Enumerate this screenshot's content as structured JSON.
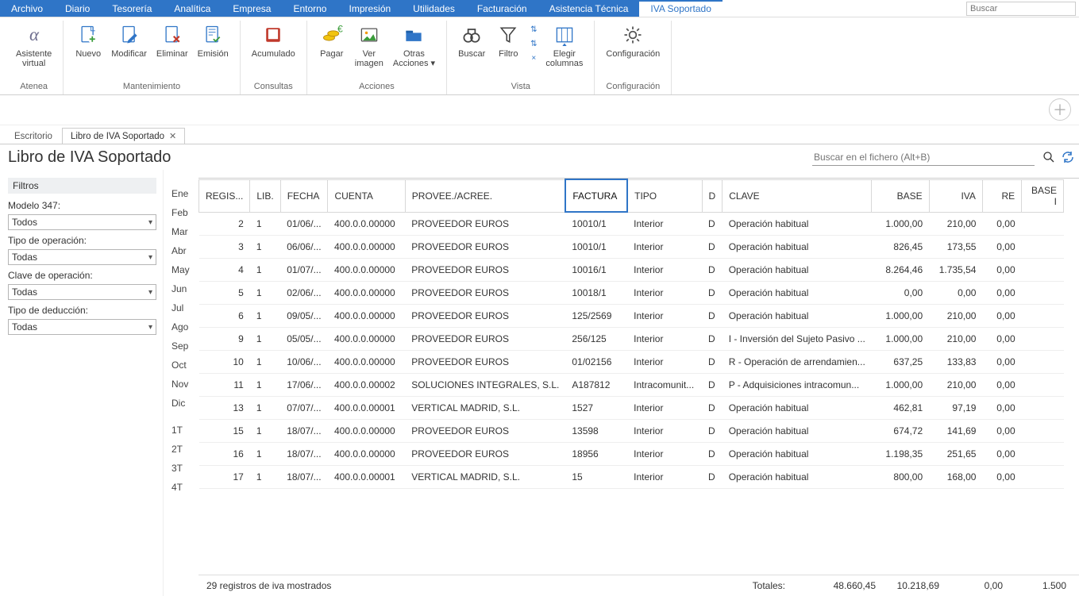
{
  "menubar": {
    "items": [
      "Archivo",
      "Diario",
      "Tesorería",
      "Analítica",
      "Empresa",
      "Entorno",
      "Impresión",
      "Utilidades",
      "Facturación",
      "Asistencia Técnica",
      "IVA Soportado"
    ],
    "active_index": 10,
    "search_placeholder": "Buscar"
  },
  "ribbon": {
    "groups": [
      {
        "label": "Atenea",
        "buttons": [
          {
            "label": "Asistente\nvirtual",
            "icon": "alpha"
          }
        ]
      },
      {
        "label": "Mantenimiento",
        "buttons": [
          {
            "label": "Nuevo",
            "icon": "doc-plus"
          },
          {
            "label": "Modificar",
            "icon": "doc-pen"
          },
          {
            "label": "Eliminar",
            "icon": "doc-x"
          },
          {
            "label": "Emisión",
            "icon": "doc-check"
          }
        ]
      },
      {
        "label": "Consultas",
        "buttons": [
          {
            "label": "Acumulado",
            "icon": "book"
          }
        ]
      },
      {
        "label": "Acciones",
        "buttons": [
          {
            "label": "Pagar",
            "icon": "coins"
          },
          {
            "label": "Ver\nimagen",
            "icon": "image"
          },
          {
            "label": "Otras\nAcciones ▾",
            "icon": "folder"
          }
        ]
      },
      {
        "label": "Vista",
        "buttons": [
          {
            "label": "Buscar",
            "icon": "binoc"
          },
          {
            "label": "Filtro",
            "icon": "funnel"
          }
        ],
        "has_sort": true,
        "extra": {
          "label": "Elegir\ncolumnas",
          "icon": "columns"
        }
      },
      {
        "label": "Configuración",
        "buttons": [
          {
            "label": "Configuración",
            "icon": "gear"
          }
        ]
      }
    ]
  },
  "tabs": {
    "escritorio": "Escritorio",
    "active": "Libro de IVA Soportado"
  },
  "page": {
    "title": "Libro de IVA Soportado",
    "filters_header": "Filtros",
    "filters": [
      {
        "label": "Modelo 347:",
        "value": "Todos"
      },
      {
        "label": "Tipo de operación:",
        "value": "Todas"
      },
      {
        "label": "Clave de operación:",
        "value": "Todas"
      },
      {
        "label": "Tipo de deducción:",
        "value": "Todas"
      }
    ],
    "search_placeholder": "Buscar en el fichero (Alt+B)"
  },
  "months": [
    "Ene",
    "Feb",
    "Mar",
    "Abr",
    "May",
    "Jun",
    "Jul",
    "Ago",
    "Sep",
    "Oct",
    "Nov",
    "Dic",
    "",
    "1T",
    "2T",
    "3T",
    "4T"
  ],
  "grid": {
    "columns": [
      "REGIS...",
      "LIB.",
      "FECHA",
      "CUENTA",
      "PROVEE./ACREE.",
      "FACTURA",
      "TIPO",
      "D",
      "CLAVE",
      "BASE",
      "IVA",
      "RE",
      "BASE I"
    ],
    "active_col_index": 5,
    "numeric_cols": [
      9,
      10,
      11,
      12
    ],
    "rows": [
      {
        "c": [
          "2",
          "1",
          "01/06/...",
          "400.0.0.00000",
          "PROVEEDOR EUROS",
          "10010/1",
          "Interior",
          "D",
          "Operación habitual",
          "1.000,00",
          "210,00",
          "0,00",
          ""
        ]
      },
      {
        "c": [
          "3",
          "1",
          "06/06/...",
          "400.0.0.00000",
          "PROVEEDOR EUROS",
          "10010/1",
          "Interior",
          "D",
          "Operación habitual",
          "826,45",
          "173,55",
          "0,00",
          ""
        ]
      },
      {
        "c": [
          "4",
          "1",
          "01/07/...",
          "400.0.0.00000",
          "PROVEEDOR EUROS",
          "10016/1",
          "Interior",
          "D",
          "Operación habitual",
          "8.264,46",
          "1.735,54",
          "0,00",
          ""
        ]
      },
      {
        "c": [
          "5",
          "1",
          "02/06/...",
          "400.0.0.00000",
          "PROVEEDOR EUROS",
          "10018/1",
          "Interior",
          "D",
          "Operación habitual",
          "0,00",
          "0,00",
          "0,00",
          ""
        ]
      },
      {
        "c": [
          "6",
          "1",
          "09/05/...",
          "400.0.0.00000",
          "PROVEEDOR EUROS",
          "125/2569",
          "Interior",
          "D",
          "Operación habitual",
          "1.000,00",
          "210,00",
          "0,00",
          ""
        ]
      },
      {
        "c": [
          "9",
          "1",
          "05/05/...",
          "400.0.0.00000",
          "PROVEEDOR EUROS",
          "256/125",
          "Interior",
          "D",
          "I - Inversión del Sujeto Pasivo ...",
          "1.000,00",
          "210,00",
          "0,00",
          ""
        ]
      },
      {
        "c": [
          "10",
          "1",
          "10/06/...",
          "400.0.0.00000",
          "PROVEEDOR EUROS",
          "01/02156",
          "Interior",
          "D",
          "R - Operación de arrendamien...",
          "637,25",
          "133,83",
          "0,00",
          ""
        ]
      },
      {
        "c": [
          "11",
          "1",
          "17/06/...",
          "400.0.0.00002",
          "SOLUCIONES INTEGRALES, S.L.",
          "A187812",
          "Intracomunit...",
          "D",
          "P - Adquisiciones intracomun...",
          "1.000,00",
          "210,00",
          "0,00",
          ""
        ]
      },
      {
        "c": [
          "13",
          "1",
          "07/07/...",
          "400.0.0.00001",
          "VERTICAL MADRID, S.L.",
          "1527",
          "Interior",
          "D",
          "Operación habitual",
          "462,81",
          "97,19",
          "0,00",
          ""
        ]
      },
      {
        "c": [
          "15",
          "1",
          "18/07/...",
          "400.0.0.00000",
          "PROVEEDOR EUROS",
          "13598",
          "Interior",
          "D",
          "Operación habitual",
          "674,72",
          "141,69",
          "0,00",
          ""
        ]
      },
      {
        "c": [
          "16",
          "1",
          "18/07/...",
          "400.0.0.00000",
          "PROVEEDOR EUROS",
          "18956",
          "Interior",
          "D",
          "Operación habitual",
          "1.198,35",
          "251,65",
          "0,00",
          ""
        ]
      },
      {
        "c": [
          "17",
          "1",
          "18/07/...",
          "400.0.0.00001",
          "VERTICAL MADRID, S.L.",
          "15",
          "Interior",
          "D",
          "Operación habitual",
          "800,00",
          "168,00",
          "0,00",
          ""
        ]
      }
    ]
  },
  "footer": {
    "count_text": "29 registros de iva mostrados",
    "totals_label": "Totales:",
    "totals": [
      "48.660,45",
      "10.218,69",
      "0,00",
      "1.500"
    ]
  }
}
